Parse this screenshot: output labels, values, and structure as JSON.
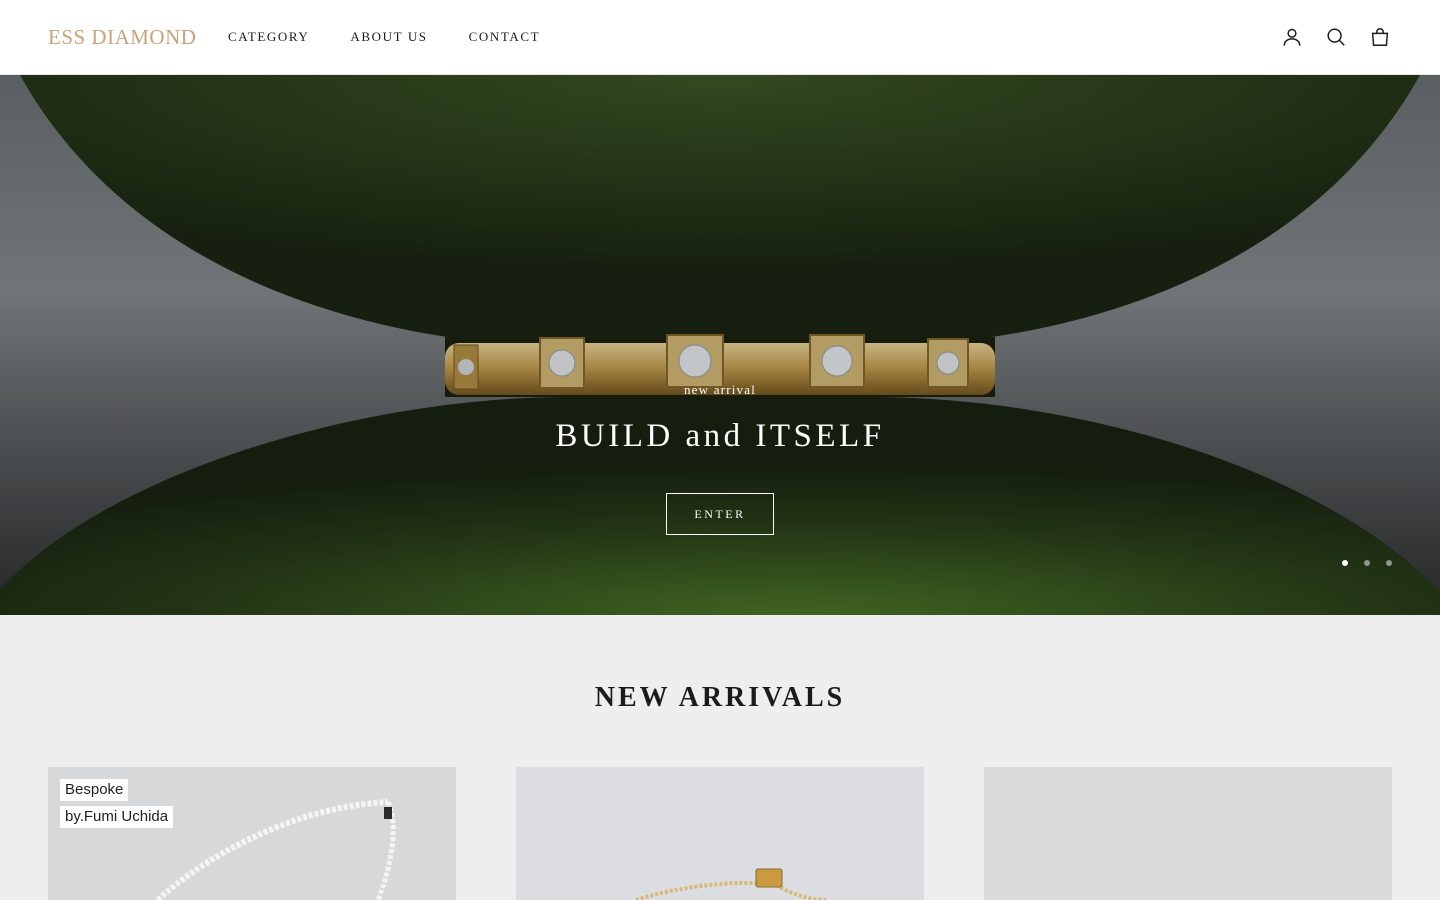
{
  "brand": {
    "logo": "ESS DIAMOND"
  },
  "nav": {
    "items": [
      "CATEGORY",
      "ABOUT US",
      "CONTACT"
    ]
  },
  "header_icons": [
    "account-icon",
    "search-icon",
    "cart-icon"
  ],
  "hero": {
    "subtitle": "new arrival",
    "title": "BUILD and ITSELF",
    "button": "ENTER",
    "slides": {
      "count": 3,
      "active": 1
    }
  },
  "new_arrivals": {
    "title": "NEW ARRIVALS",
    "products": [
      {
        "tag_line1": "Bespoke",
        "tag_line2": "by.Fumi Uchida"
      },
      {},
      {}
    ]
  },
  "colors": {
    "logo": "#c9a27a",
    "text": "#1c1b1b",
    "section_bg": "#eeeeee"
  }
}
